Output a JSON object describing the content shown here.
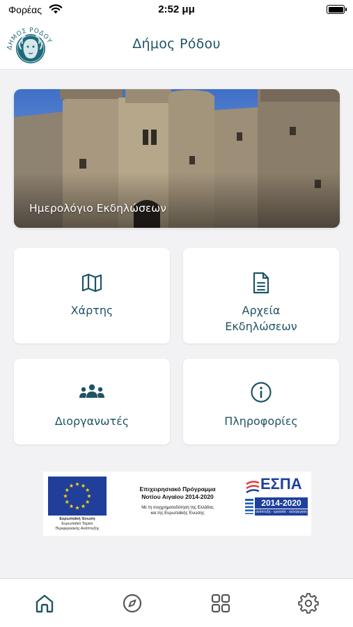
{
  "status_bar": {
    "carrier": "Φορέας",
    "time": "2:52 μμ"
  },
  "header": {
    "title": "Δήμος Ρόδου",
    "logo_text": "ΔΗΜΟΣ ΡΟΔΟΥ"
  },
  "hero": {
    "label": "Ημερολόγιο Εκδηλώσεων",
    "image": "castle-of-the-grand-master-photo"
  },
  "tiles": {
    "map": {
      "label": "Χάρτης",
      "icon": "map-icon"
    },
    "files": {
      "label_line1": "Αρχεία",
      "label_line2": "Εκδηλώσεων",
      "icon": "document-icon"
    },
    "organizers": {
      "label": "Διοργανωτές",
      "icon": "users-icon"
    },
    "info": {
      "label": "Πληροφορίες",
      "icon": "info-icon"
    }
  },
  "eu_banner": {
    "eu_caption_title": "Ευρωπαϊκή Ένωση",
    "eu_caption_line1": "Ευρωπαϊκό Ταμείο",
    "eu_caption_line2": "Περιφερειακής Ανάπτυξης",
    "program_title_line1": "Επιχειρησιακό Πρόγραμμα",
    "program_title_line2": "Νοτίου Αιγαίου 2014-2020",
    "program_sub_line1": "Με τη συγχρηματοδότηση της Ελλάδας",
    "program_sub_line2": "και της Ευρωπαϊκής Ένωσης",
    "espa_title": "ΕΣΠΑ",
    "espa_years": "2014-2020",
    "espa_tagline": "ανάπτυξη - εργασία - αλληλεγγύη"
  },
  "tab_bar": {
    "items": [
      {
        "name": "home",
        "icon": "home-icon",
        "active": true
      },
      {
        "name": "explore",
        "icon": "compass-icon",
        "active": false
      },
      {
        "name": "apps",
        "icon": "grid-icon",
        "active": false
      },
      {
        "name": "settings",
        "icon": "gear-icon",
        "active": false
      }
    ]
  },
  "colors": {
    "accent": "#1e5466",
    "background": "#f2f2f4",
    "eu_blue": "#1f3f9a",
    "eu_star": "#ffd400"
  }
}
